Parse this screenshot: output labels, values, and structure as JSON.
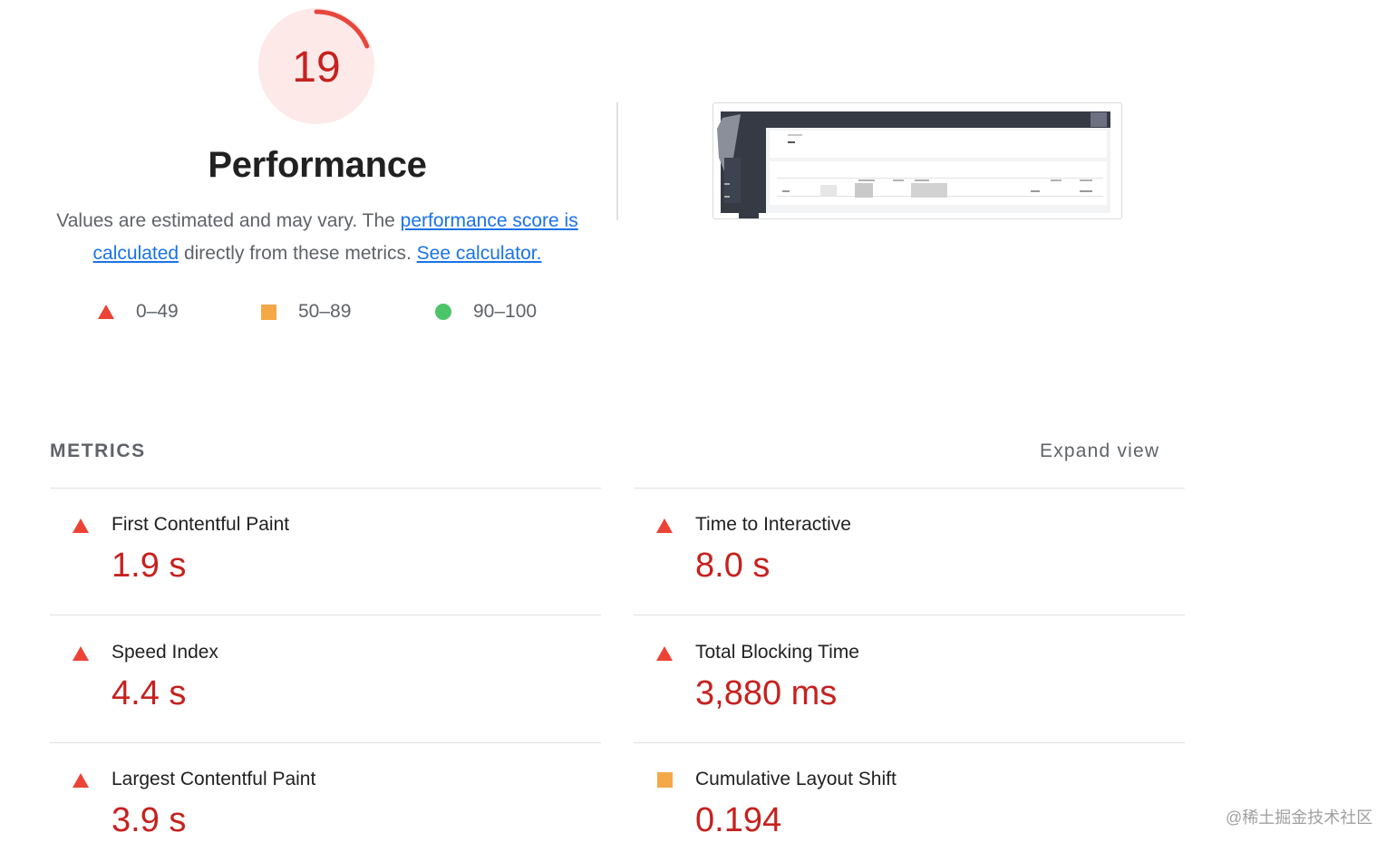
{
  "gauge": {
    "score": "19",
    "fraction": 0.19,
    "color": "#e8453c",
    "fill": "#fde9e8"
  },
  "title": "Performance",
  "description": {
    "text1": "Values are estimated and may vary. The ",
    "link1": "performance score is calculated",
    "text2": " directly from these metrics. ",
    "link2": "See calculator."
  },
  "legend": [
    {
      "icon": "triangle-icon",
      "label": "0–49",
      "color": "#eb4335"
    },
    {
      "icon": "square-icon",
      "label": "50–89",
      "color": "#f4a847"
    },
    {
      "icon": "circle-icon",
      "label": "90–100",
      "color": "#4cc46a"
    }
  ],
  "metrics": {
    "header": "METRICS",
    "expand": "Expand view",
    "items": [
      {
        "label": "First Contentful Paint",
        "value": "1.9 s",
        "rating": "fail"
      },
      {
        "label": "Time to Interactive",
        "value": "8.0 s",
        "rating": "fail"
      },
      {
        "label": "Speed Index",
        "value": "4.4 s",
        "rating": "fail"
      },
      {
        "label": "Total Blocking Time",
        "value": "3,880 ms",
        "rating": "fail"
      },
      {
        "label": "Largest Contentful Paint",
        "value": "3.9 s",
        "rating": "fail"
      },
      {
        "label": "Cumulative Layout Shift",
        "value": "0.194",
        "rating": "average"
      }
    ]
  },
  "watermark": "@稀土掘金技术社区"
}
